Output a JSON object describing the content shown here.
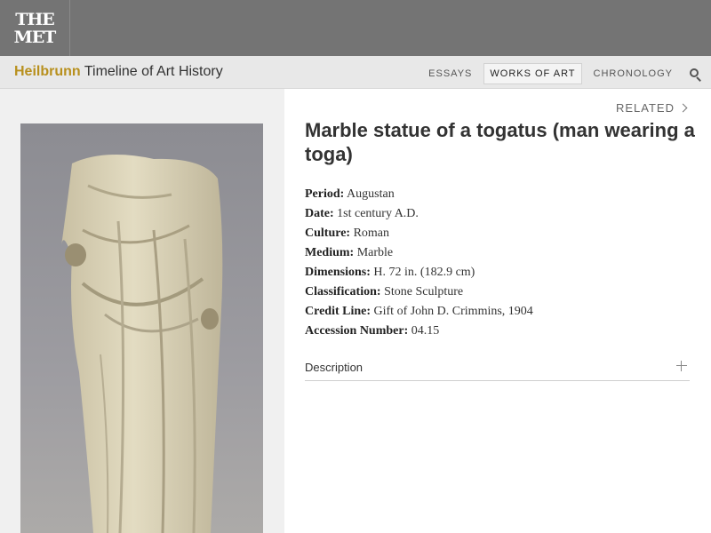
{
  "header": {
    "logo_line1": "THE",
    "logo_line2": "MET"
  },
  "subnav": {
    "brand_accent": "Heilbrunn",
    "brand_rest": " Timeline of Art History",
    "links": [
      "ESSAYS",
      "WORKS OF ART",
      "CHRONOLOGY"
    ],
    "active_link": "WORKS OF ART",
    "search_icon": "search-icon"
  },
  "related_label": "RELATED",
  "title": "Marble statue of a togatus (man wearing a toga)",
  "metadata": [
    {
      "label": "Period:",
      "value": " Augustan"
    },
    {
      "label": "Date:",
      "value": " 1st century A.D."
    },
    {
      "label": "Culture:",
      "value": " Roman"
    },
    {
      "label": "Medium:",
      "value": " Marble"
    },
    {
      "label": "Dimensions:",
      "value": " H. 72 in. (182.9 cm)"
    },
    {
      "label": "Classification:",
      "value": " Stone Sculpture"
    },
    {
      "label": "Credit Line:",
      "value": " Gift of John D. Crimmins, 1904"
    },
    {
      "label": "Accession Number:",
      "value": " 04.15"
    }
  ],
  "description_label": "Description",
  "colors": {
    "brand_gold": "#b8901e",
    "topbar": "#747474"
  }
}
